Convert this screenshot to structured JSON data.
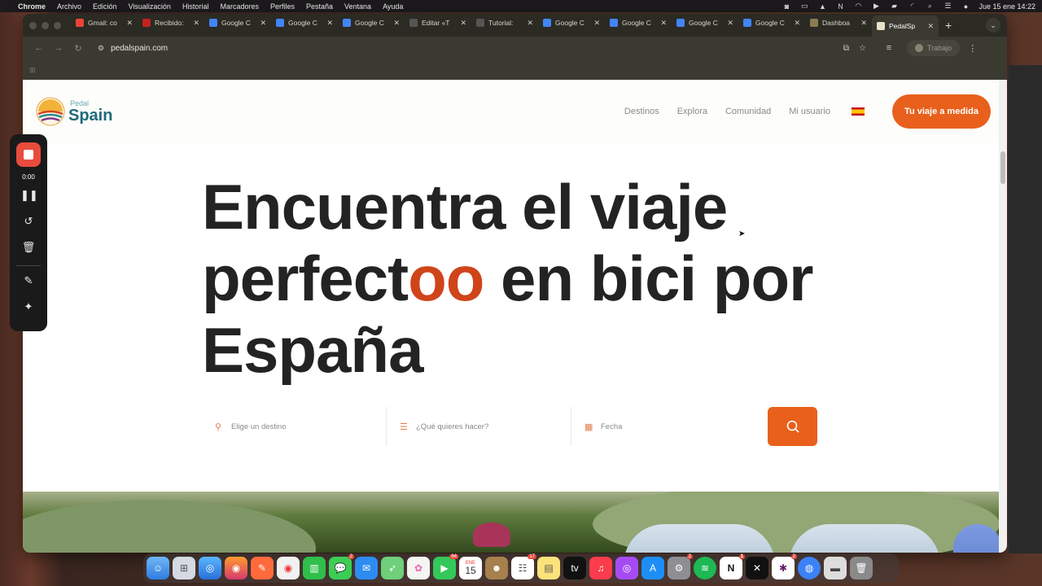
{
  "menubar": {
    "app": "Chrome",
    "items": [
      "Archivo",
      "Edición",
      "Visualización",
      "Historial",
      "Marcadores",
      "Perfiles",
      "Pestaña",
      "Ventana",
      "Ayuda"
    ],
    "clock": "Jue 15 ene 14:22"
  },
  "tabs": [
    {
      "label": "Gmail: co",
      "icon": "gmail-icon",
      "color": "#ea4335"
    },
    {
      "label": "Recibido:",
      "icon": "gmail-icon",
      "color": "#c5221f"
    },
    {
      "label": "Google C",
      "icon": "google-cloud-icon",
      "color": "#4285f4"
    },
    {
      "label": "Google C",
      "icon": "google-cloud-icon",
      "color": "#4285f4"
    },
    {
      "label": "Google C",
      "icon": "google-cloud-icon",
      "color": "#4285f4"
    },
    {
      "label": "Editar «T",
      "icon": "wordpress-icon",
      "color": "#555555"
    },
    {
      "label": "Tutorial:",
      "icon": "wordpress-icon",
      "color": "#555555"
    },
    {
      "label": "Google C",
      "icon": "google-cloud-icon",
      "color": "#4285f4"
    },
    {
      "label": "Google C",
      "icon": "google-cloud-icon",
      "color": "#4285f4"
    },
    {
      "label": "Google C",
      "icon": "google-cloud-icon",
      "color": "#4285f4"
    },
    {
      "label": "Google C",
      "icon": "google-cloud-icon",
      "color": "#4285f4"
    },
    {
      "label": "Dashboa",
      "icon": "dashboard-icon",
      "color": "#8a7a55"
    },
    {
      "label": "PedalSp",
      "icon": "pedalspain-icon",
      "color": "#e8e2c8",
      "active": true
    }
  ],
  "toolbar": {
    "url": "pedalspain.com",
    "profile_label": "Trabajo"
  },
  "site": {
    "logo_small": "Pedal",
    "logo_big": "Spain",
    "nav": [
      "Destinos",
      "Explora",
      "Comunidad",
      "Mi usuario"
    ],
    "cta": "Tu viaje a medida",
    "hero_line1": "Encuentra el viaje",
    "hero_line2_a": "perfect",
    "hero_line2_accent": "oo",
    "hero_line2_b": " en bici por",
    "hero_line3": "España",
    "search": {
      "destination_placeholder": "Elige un destino",
      "activity_placeholder": "¿Qué quieres hacer?",
      "date_placeholder": "Fecha"
    },
    "accent_color": "#e8601c"
  },
  "recorder": {
    "time": "0:00"
  },
  "dock": {
    "badges": {
      "messages": "2",
      "facetime": "64",
      "reminders": "17",
      "system-settings": "2",
      "notion": "1",
      "slack": "2"
    },
    "calendar_month": "ENE",
    "calendar_day": "15"
  }
}
